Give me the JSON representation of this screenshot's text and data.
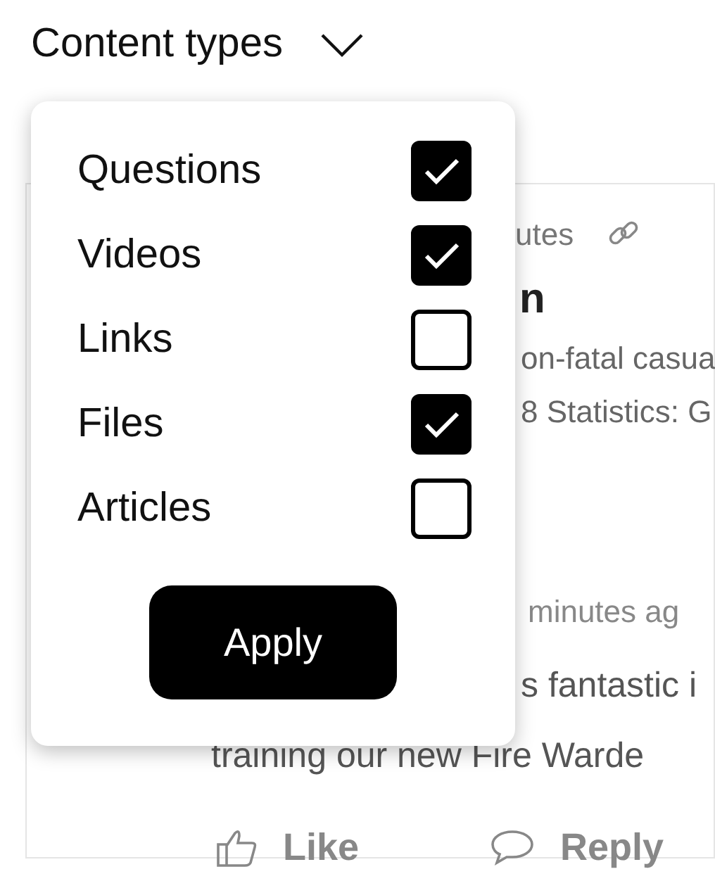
{
  "filter": {
    "label": "Content types",
    "options": [
      {
        "label": "Questions",
        "checked": true
      },
      {
        "label": "Videos",
        "checked": true
      },
      {
        "label": "Links",
        "checked": false
      },
      {
        "label": "Files",
        "checked": true
      },
      {
        "label": "Articles",
        "checked": false
      }
    ],
    "apply": "Apply"
  },
  "post": {
    "meta": "utes",
    "title": "n",
    "excerpt_lines": [
      "on-fatal casua",
      "8 Statistics: G"
    ]
  },
  "comment": {
    "meta": "minutes ag",
    "body_lines": [
      "s fantastic i",
      "training our new Fire Warde"
    ],
    "actions": [
      {
        "kind": "like",
        "label": "Like"
      },
      {
        "kind": "reply",
        "label": "Reply"
      }
    ]
  }
}
